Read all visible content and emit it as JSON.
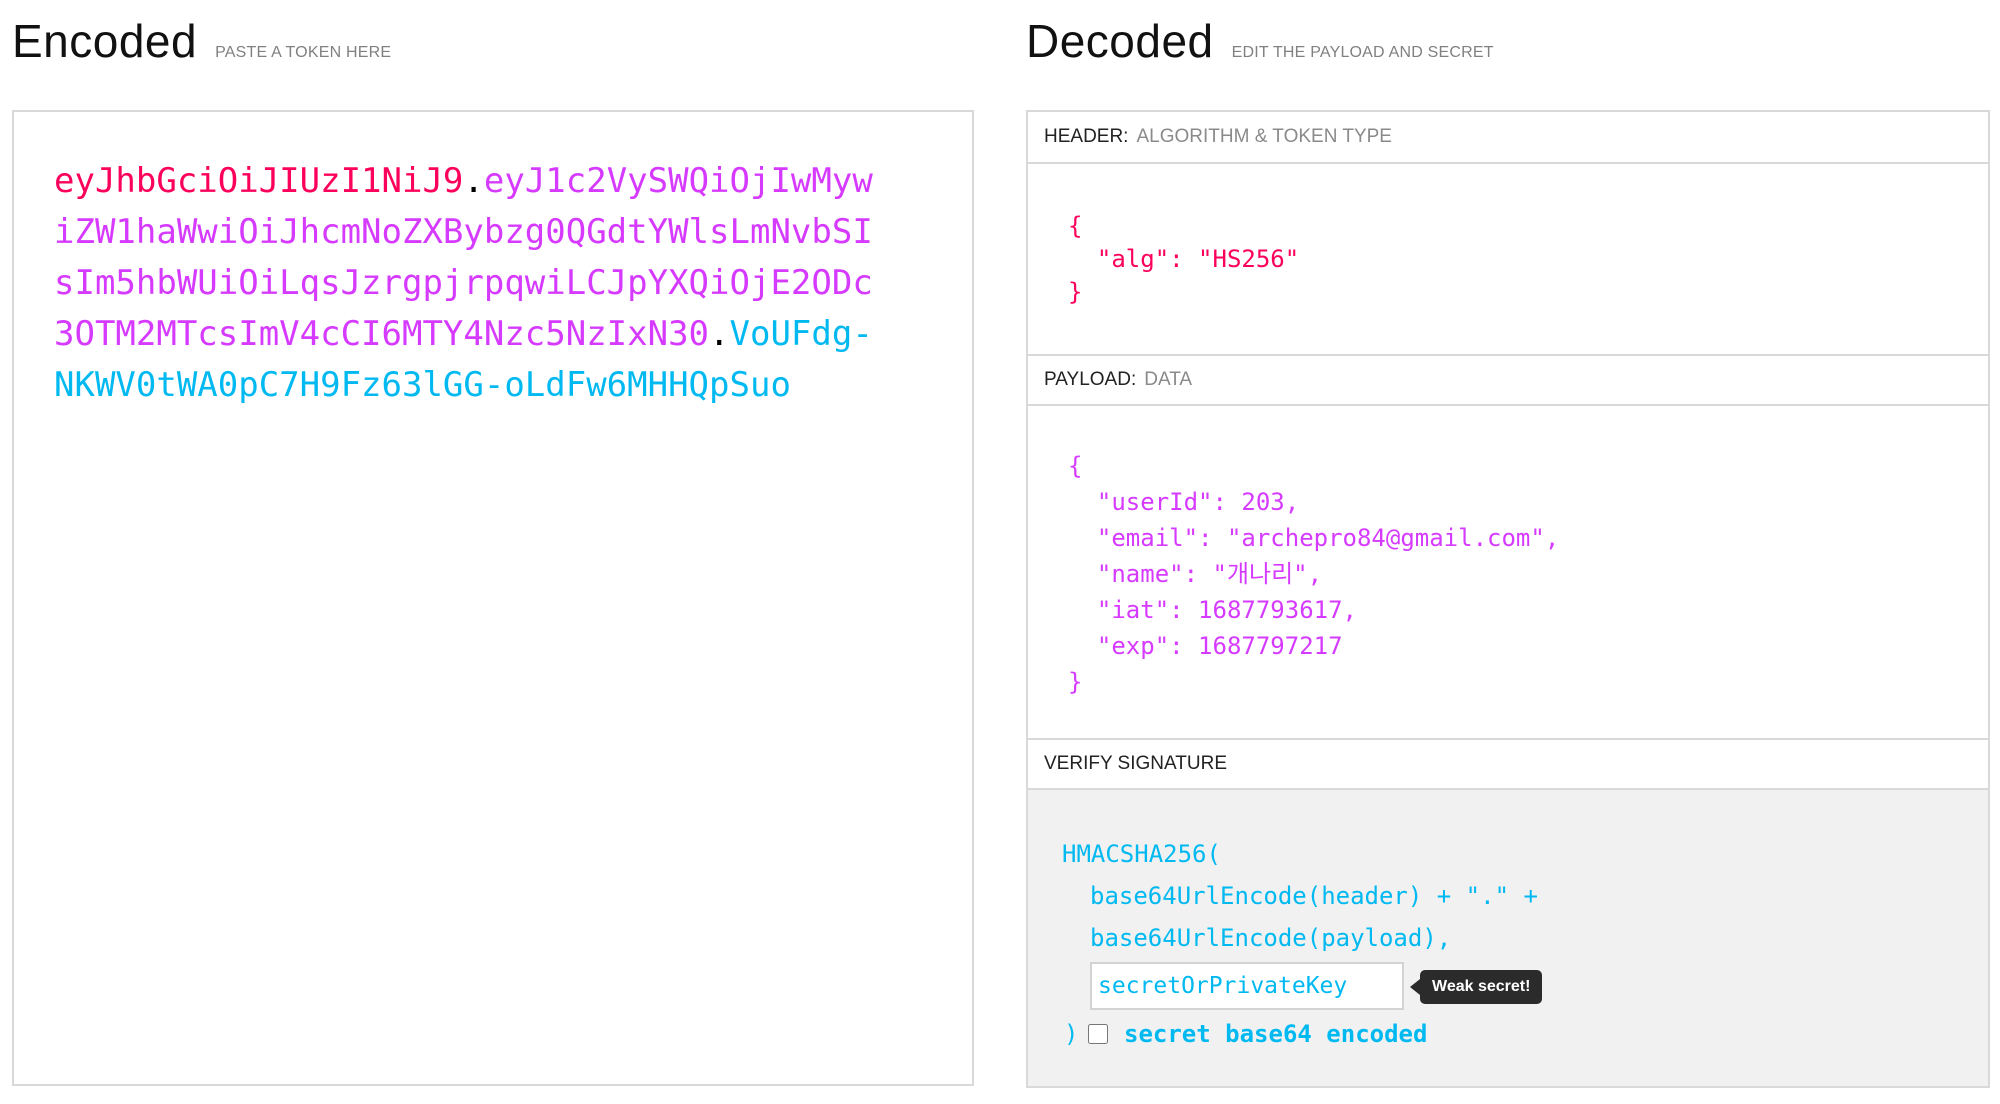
{
  "encoded": {
    "title": "Encoded",
    "subtitle": "PASTE A TOKEN HERE",
    "token_header": "eyJhbGciOiJIUzI1NiJ9",
    "token_payload": "eyJ1c2VySWQiOjIwMywiZW1haWwiOiJhcmNoZXBybzg0QGdtYWlsLmNvbSIsIm5hbWUiOiLqsJzrgpjrpqwiLCJpYXQiOjE2ODc3OTM2MTcsImV4cCI6MTY4Nzc5NzIxN30",
    "token_signature": "VoUFdg-NKWV0tWA0pC7H9Fz63lGG-oLdFw6MHHQpSuo",
    "dot": "."
  },
  "decoded": {
    "title": "Decoded",
    "subtitle": "EDIT THE PAYLOAD AND SECRET",
    "header_section": {
      "label": "HEADER:",
      "sub": "ALGORITHM & TOKEN TYPE",
      "json": "{\n  \"alg\": \"HS256\"\n}"
    },
    "payload_section": {
      "label": "PAYLOAD:",
      "sub": "DATA",
      "json": "{\n  \"userId\": 203,\n  \"email\": \"archepro84@gmail.com\",\n  \"name\": \"개나리\",\n  \"iat\": 1687793617,\n  \"exp\": 1687797217\n}"
    },
    "verify_section": {
      "label": "VERIFY SIGNATURE",
      "fn_open": "HMACSHA256(",
      "header_line": "base64UrlEncode(header) + \".\" +",
      "payload_line": "base64UrlEncode(payload),",
      "secret_placeholder": "secretOrPrivateKey",
      "secret_value": "",
      "weak_tooltip": "Weak secret!",
      "close_paren": ")",
      "base64_label": "secret base64 encoded",
      "base64_checked": false
    }
  },
  "colors": {
    "header": "#fb015b",
    "payload": "#d63aff",
    "signature": "#00b9f1",
    "border": "#d9d9d9",
    "verify_bg": "#f1f1f1"
  }
}
